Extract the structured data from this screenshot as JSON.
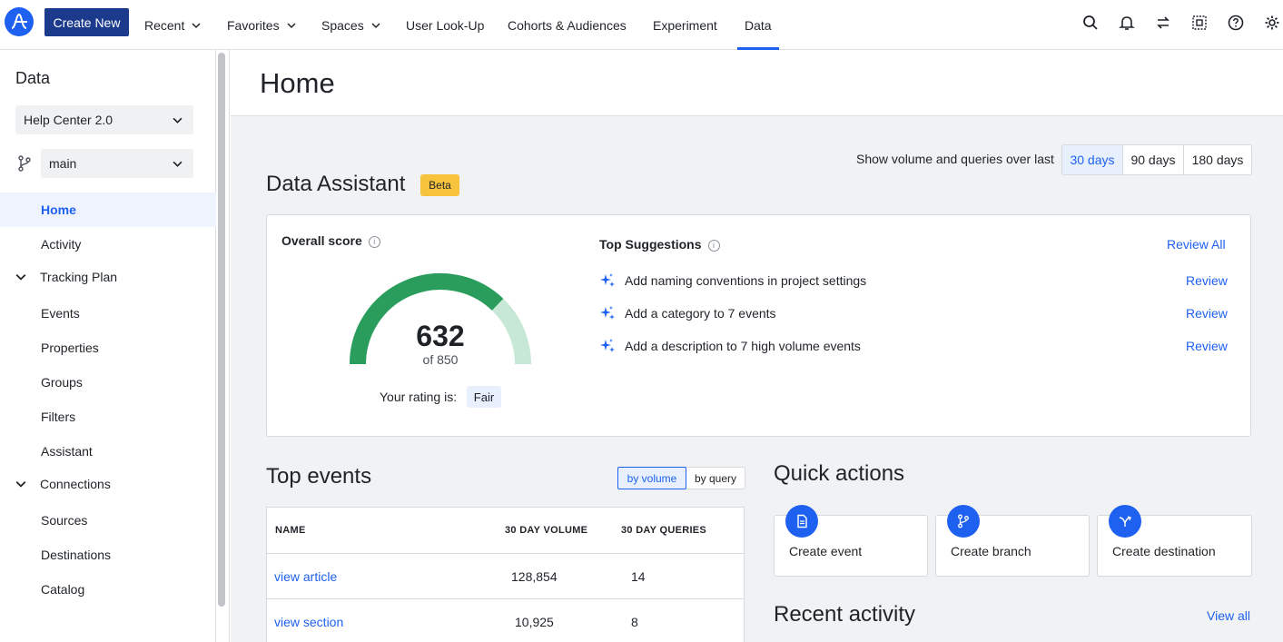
{
  "topnav": {
    "create_label": "Create New",
    "items": [
      {
        "label": "Recent"
      },
      {
        "label": "Favorites"
      },
      {
        "label": "Spaces"
      },
      {
        "label": "User Look-Up"
      },
      {
        "label": "Cohorts & Audiences"
      },
      {
        "label": "Experiment"
      },
      {
        "label": "Data"
      }
    ],
    "active": "Data",
    "icons": [
      "search-icon",
      "bell-icon",
      "switch-icon",
      "apps-icon",
      "help-icon",
      "gear-icon"
    ],
    "accent": "#1e61f0",
    "brand": "#1b3a8c"
  },
  "sidebar": {
    "title": "Data",
    "project_select": "Help Center 2.0",
    "branch_select": "main",
    "items": {
      "home": "Home",
      "activity": "Activity",
      "tracking_plan": "Tracking Plan",
      "events": "Events",
      "properties": "Properties",
      "groups": "Groups",
      "filters": "Filters",
      "assistant": "Assistant",
      "connections": "Connections",
      "sources": "Sources",
      "destinations": "Destinations",
      "catalog": "Catalog"
    },
    "active": "Home"
  },
  "main": {
    "title": "Home",
    "range_label": "Show volume and queries over last",
    "range_options": [
      "30 days",
      "90 days",
      "180 days"
    ],
    "range_selected": "30 days",
    "assistant": {
      "title": "Data Assistant",
      "badge": "Beta",
      "score_label": "Overall score",
      "score": "632",
      "score_max": "of 850",
      "score_value": 632,
      "score_total": 850,
      "rating_label": "Your rating is:",
      "rating": "Fair",
      "suggestions_title": "Top Suggestions",
      "review_all": "Review All",
      "suggestions": [
        {
          "text": "Add naming conventions in project settings",
          "action": "Review"
        },
        {
          "text": "Add a category to 7 events",
          "action": "Review"
        },
        {
          "text": "Add a description to 7 high volume events",
          "action": "Review"
        }
      ],
      "gauge_colors": {
        "fill": "#2a9d5c",
        "track": "#c7e8d6"
      }
    },
    "top_events": {
      "title": "Top events",
      "toggle": [
        "by volume",
        "by query"
      ],
      "toggle_selected": "by volume",
      "columns": [
        "NAME",
        "30 DAY VOLUME",
        "30 DAY QUERIES"
      ],
      "rows": [
        {
          "name": "view article",
          "volume": "128,854",
          "queries": "14"
        },
        {
          "name": "view section",
          "volume": "10,925",
          "queries": "8"
        }
      ]
    },
    "quick_actions": {
      "title": "Quick actions",
      "items": [
        {
          "label": "Create event",
          "icon": "document-icon"
        },
        {
          "label": "Create branch",
          "icon": "branch-icon"
        },
        {
          "label": "Create destination",
          "icon": "destination-icon"
        }
      ]
    },
    "recent_activity": {
      "title": "Recent activity",
      "view_all": "View all"
    }
  }
}
